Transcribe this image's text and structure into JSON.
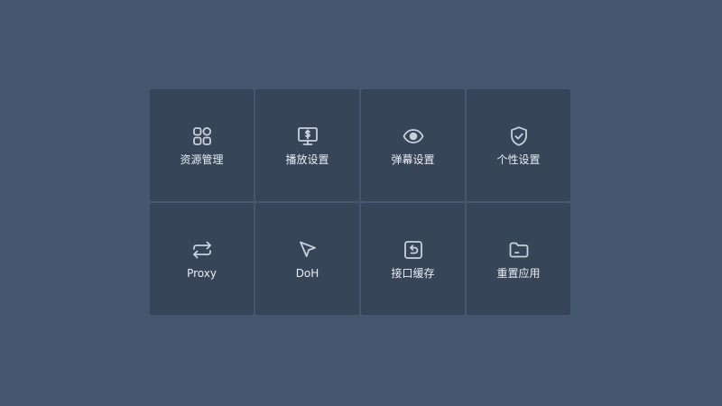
{
  "settings_menu": {
    "items": [
      {
        "label": "资源管理",
        "icon": "resources-icon"
      },
      {
        "label": "播放设置",
        "icon": "monitor-icon"
      },
      {
        "label": "弹幕设置",
        "icon": "eye-icon"
      },
      {
        "label": "个性设置",
        "icon": "shield-check-icon"
      },
      {
        "label": "Proxy",
        "icon": "repeat-icon"
      },
      {
        "label": "DoH",
        "icon": "cursor-icon"
      },
      {
        "label": "接口缓存",
        "icon": "undo-box-icon"
      },
      {
        "label": "重置应用",
        "icon": "folder-icon"
      }
    ]
  },
  "colors": {
    "background": "#45576f",
    "tile": "#374559",
    "icon": "#c8d0da",
    "text": "#e9edf2"
  }
}
